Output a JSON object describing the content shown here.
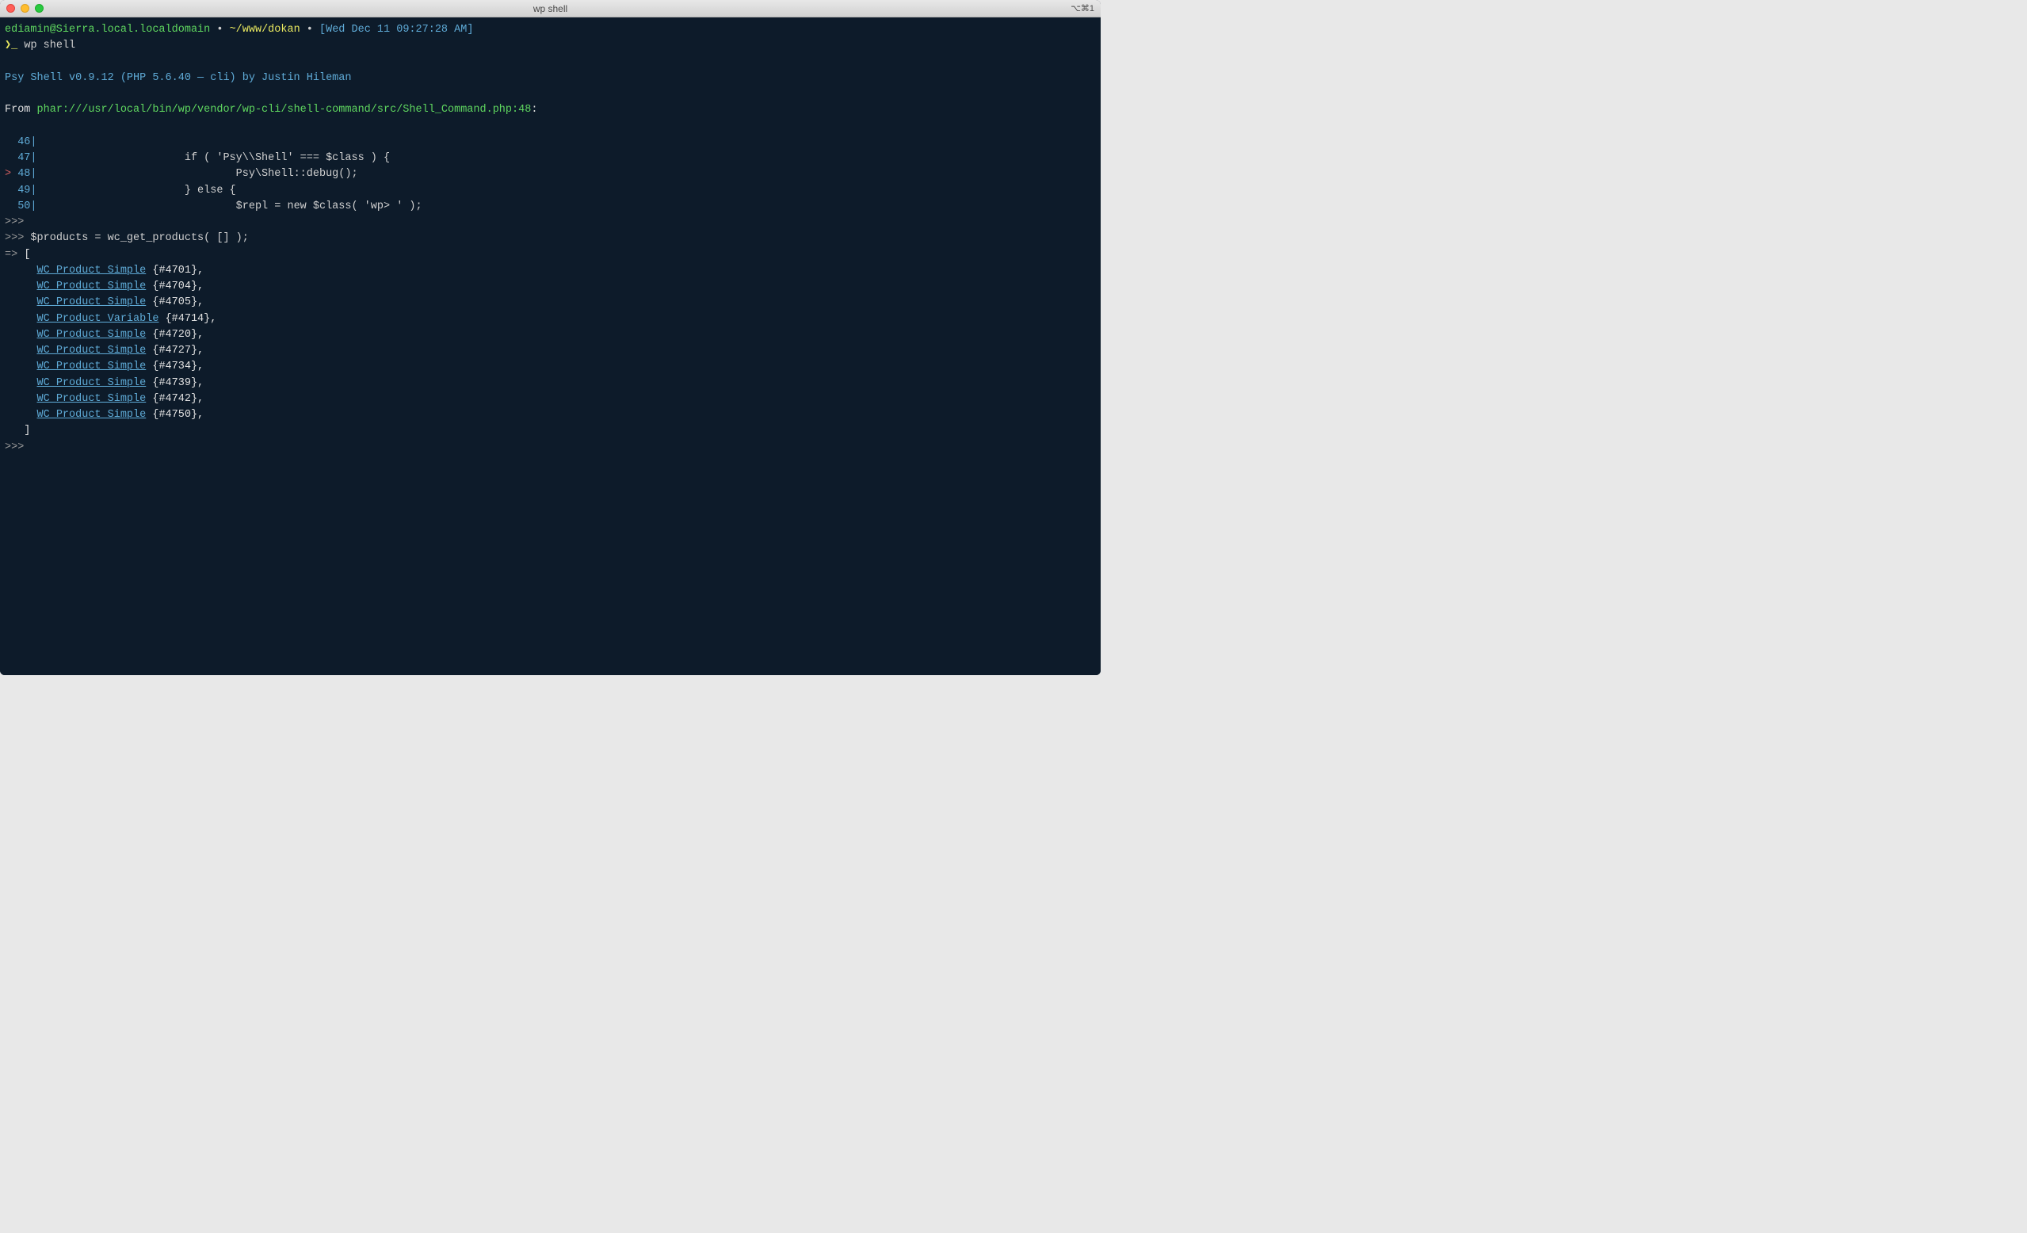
{
  "window": {
    "title": "wp shell",
    "right_indicator": "⌥⌘1"
  },
  "prompt": {
    "user_host": "ediamin@Sierra.local.localdomain",
    "separator": " • ",
    "path": "~/www/dokan",
    "timestamp": "[Wed Dec 11 09:27:28 AM]",
    "ps1_arrow": "❯",
    "ps1_underscore": "_",
    "command": " wp shell"
  },
  "psy_banner": "Psy Shell v0.9.12 (PHP 5.6.40 — cli) by Justin Hileman",
  "from_label": "From ",
  "phar_path": "phar:///usr/local/bin/wp/vendor/wp-cli/shell-command/src/Shell_Command.php:48",
  "colon": ":",
  "code_lines": [
    {
      "marker": "  ",
      "num": "46",
      "pipe": "|",
      "code": ""
    },
    {
      "marker": "  ",
      "num": "47",
      "pipe": "|",
      "code": "                      if ( 'Psy\\\\Shell' === $class ) {"
    },
    {
      "marker": "> ",
      "num": "48",
      "pipe": "|",
      "code": "                              Psy\\Shell::debug();"
    },
    {
      "marker": "  ",
      "num": "49",
      "pipe": "|",
      "code": "                      } else {"
    },
    {
      "marker": "  ",
      "num": "50",
      "pipe": "|",
      "code": "                              $repl = new $class( 'wp> ' );"
    }
  ],
  "repl": {
    "prompt": ">>>",
    "arrow": "=> ",
    "command": " $products = wc_get_products( [] );",
    "open_bracket": "[",
    "close_bracket": "   ]",
    "products": [
      {
        "class": "WC_Product_Simple",
        "id": "{#4701}"
      },
      {
        "class": "WC_Product_Simple",
        "id": "{#4704}"
      },
      {
        "class": "WC_Product_Simple",
        "id": "{#4705}"
      },
      {
        "class": "WC_Product_Variable",
        "id": "{#4714}"
      },
      {
        "class": "WC_Product_Simple",
        "id": "{#4720}"
      },
      {
        "class": "WC_Product_Simple",
        "id": "{#4727}"
      },
      {
        "class": "WC_Product_Simple",
        "id": "{#4734}"
      },
      {
        "class": "WC_Product_Simple",
        "id": "{#4739}"
      },
      {
        "class": "WC_Product_Simple",
        "id": "{#4742}"
      },
      {
        "class": "WC_Product_Simple",
        "id": "{#4750}"
      }
    ]
  }
}
